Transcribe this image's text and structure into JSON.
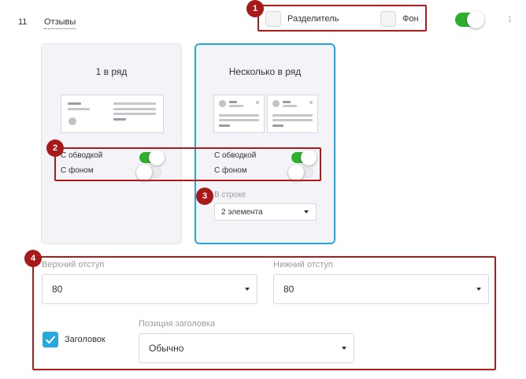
{
  "header": {
    "row_number": "11",
    "section_name": "Отзывы",
    "divider_label": "Разделитель",
    "background_label": "Фон",
    "enabled": true
  },
  "layouts": [
    {
      "title": "1 в ряд",
      "border_label": "С обводкой",
      "border_on": true,
      "background_label": "С фоном",
      "background_on": false,
      "selected": false
    },
    {
      "title": "Несколько в ряд",
      "border_label": "С обводкой",
      "border_on": true,
      "background_label": "С фоном",
      "background_on": false,
      "selected": true,
      "per_row_label": "В строке",
      "per_row_value": "2 элемента"
    }
  ],
  "spacing": {
    "top_label": "Верхний отступ",
    "top_value": "80",
    "bottom_label": "Нижний отступ",
    "bottom_value": "80"
  },
  "heading": {
    "label": "Заголовок",
    "checked": true,
    "position_label": "Позиция заголовка",
    "position_value": "Обычно"
  },
  "annotations": [
    "1",
    "2",
    "3",
    "4"
  ],
  "colors": {
    "accent_green": "#2eaf2e",
    "accent_blue": "#29a8e0",
    "annotation_red": "#b01c1c"
  }
}
